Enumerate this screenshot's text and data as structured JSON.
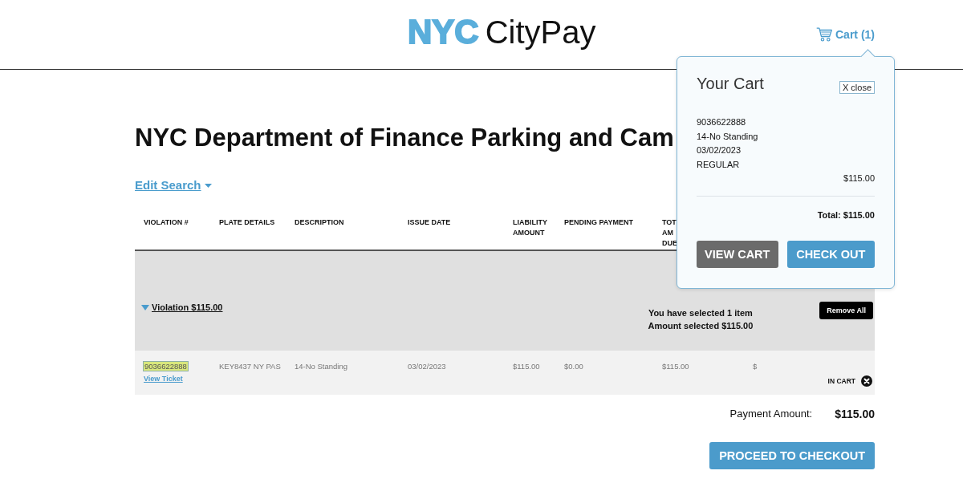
{
  "header": {
    "logo": {
      "mark": "NYC",
      "name": "CityPay"
    },
    "cart_link": {
      "label": "Cart (1)"
    }
  },
  "page_title": "NYC Department of Finance Parking and Cam",
  "edit_search": {
    "label": "Edit Search"
  },
  "table": {
    "columns": [
      "VIOLATION #",
      "PLATE DETAILS",
      "DESCRIPTION",
      "ISSUE DATE",
      "LIABILITY AMOUNT",
      "PENDING PAYMENT",
      "TOT AM DUE"
    ],
    "groups": [
      {
        "label": "Violation $115.00",
        "expanded": true,
        "selection_summary": [
          "You have selected 1 item",
          "Amount selected $115.00"
        ],
        "remove_all": "Remove All",
        "rows": [
          {
            "violation": "9036622888",
            "highlighted": true,
            "view_ticket": "View Ticket",
            "plate": "KEY8437 NY PAS",
            "description": "14-No Standing",
            "issue_date": "03/02/2023",
            "liability": "$115.00",
            "pending": "$0.00",
            "total_due": "$115.00",
            "column_8": "$",
            "status": "IN CART"
          }
        ]
      }
    ]
  },
  "payment": {
    "label": "Payment Amount:",
    "amount": "$115.00"
  },
  "proceed_button": "PROCEED TO CHECKOUT",
  "cart_popover": {
    "title": "Your Cart",
    "close": "X close",
    "items": [
      {
        "lines": [
          "9036622888",
          "14-No Standing",
          "03/02/2023",
          "REGULAR"
        ],
        "price": "$115.00"
      }
    ],
    "total": "Total: $115.00",
    "buttons": [
      {
        "label": "VIEW CART",
        "kind": "secondary"
      },
      {
        "label": "CHECK OUT",
        "kind": "primary"
      }
    ]
  }
}
